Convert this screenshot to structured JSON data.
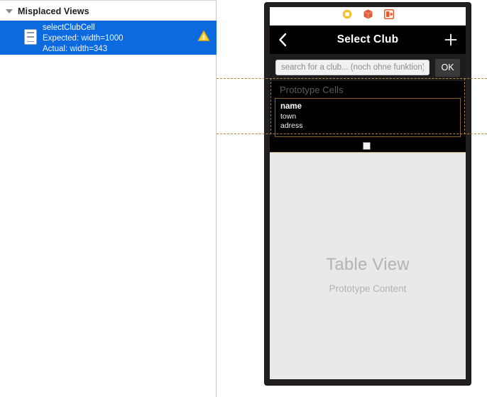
{
  "issue_navigator": {
    "group": {
      "disclosure_icon": "triangle-down-icon",
      "title": "Misplaced Views"
    },
    "selected_issue": {
      "icon": "table-view-cell-icon",
      "title": "selectClubCell",
      "expected": "Expected: width=1000",
      "actual": "Actual: width=343",
      "badge_icon": "warning-triangle-icon",
      "selection_color": "#0b6ae0",
      "badge_color": "#f5c02a"
    }
  },
  "canvas": {
    "scene_dock": {
      "icons": [
        {
          "name": "view-controller-icon",
          "color": "#f5c12e"
        },
        {
          "name": "first-responder-icon",
          "color": "#e8582c"
        },
        {
          "name": "exit-icon",
          "color": "#e8582c"
        }
      ]
    },
    "nav_bar": {
      "back_icon": "chevron-left-icon",
      "title": "Select Club",
      "add_icon": "plus-icon",
      "background": "#000000"
    },
    "search_bar": {
      "placeholder": "search for a club... (noch ohne funktion)",
      "value": "",
      "ok_label": "OK"
    },
    "prototype_cells": {
      "header": "Prototype Cells",
      "cell": {
        "name": "name",
        "town": "town",
        "adress": "adress"
      },
      "selection_color": "#b08a34"
    },
    "table_view": {
      "title": "Table View",
      "subtitle": "Prototype Content",
      "background": "#e9e9e9"
    },
    "resize_handle_icon": "resize-handle-icon"
  }
}
